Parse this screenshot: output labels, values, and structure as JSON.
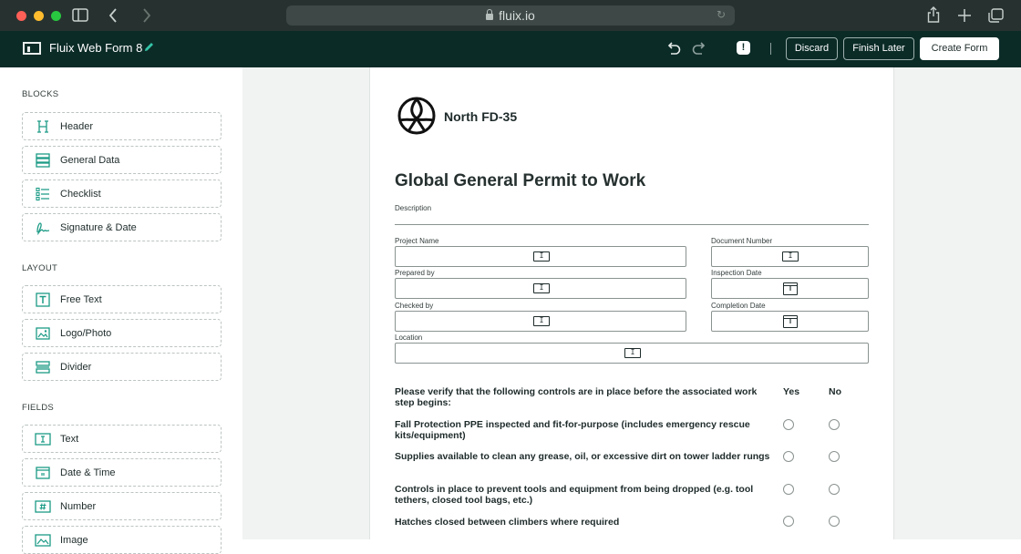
{
  "browser": {
    "url": "fluix.io",
    "icons": [
      "sidebar-icon",
      "back-icon",
      "forward-icon",
      "reload-icon",
      "share-icon",
      "new-tab-icon",
      "tabs-icon"
    ]
  },
  "app": {
    "title": "Fluix Web Form 8",
    "buttons": {
      "discard": "Discard",
      "finish_later": "Finish Later",
      "create_form": "Create Form"
    },
    "alert_symbol": "!"
  },
  "sidebar": {
    "blocks_title": "BLOCKS",
    "blocks": [
      {
        "label": "Header",
        "icon": "header-icon"
      },
      {
        "label": "General Data",
        "icon": "general-data-icon"
      },
      {
        "label": "Checklist",
        "icon": "checklist-icon"
      },
      {
        "label": "Signature & Date",
        "icon": "signature-icon"
      }
    ],
    "layout_title": "LAYOUT",
    "layout": [
      {
        "label": "Free Text",
        "icon": "free-text-icon"
      },
      {
        "label": "Logo/Photo",
        "icon": "photo-icon"
      },
      {
        "label": "Divider",
        "icon": "divider-icon"
      }
    ],
    "fields_title": "FIELDS",
    "fields": [
      {
        "label": "Text",
        "icon": "text-field-icon"
      },
      {
        "label": "Date & Time",
        "icon": "calendar-icon"
      },
      {
        "label": "Number",
        "icon": "number-icon"
      },
      {
        "label": "Image",
        "icon": "image-icon"
      }
    ]
  },
  "form": {
    "org_name": "North FD-35",
    "title": "Global General Permit to Work",
    "description_label": "Description",
    "fields": {
      "project_name": "Project Name",
      "document_number": "Document Number",
      "prepared_by": "Prepared by",
      "inspection_date": "Inspection Date",
      "checked_by": "Checked by",
      "completion_date": "Completion Date",
      "location": "Location"
    },
    "checklist": {
      "question": "Please verify that the following controls are in place before the associated work step begins:",
      "yes_label": "Yes",
      "no_label": "No",
      "items": [
        "Fall Protection PPE inspected and fit-for-purpose (includes emergency rescue kits/equipment)",
        "Supplies available to clean any grease, oil, or excessive dirt on tower ladder rungs",
        "Controls in place to prevent tools and equipment from being dropped (e.g. tool tethers, closed tool bags, etc.)",
        "Hatches closed between climbers where required"
      ]
    }
  }
}
